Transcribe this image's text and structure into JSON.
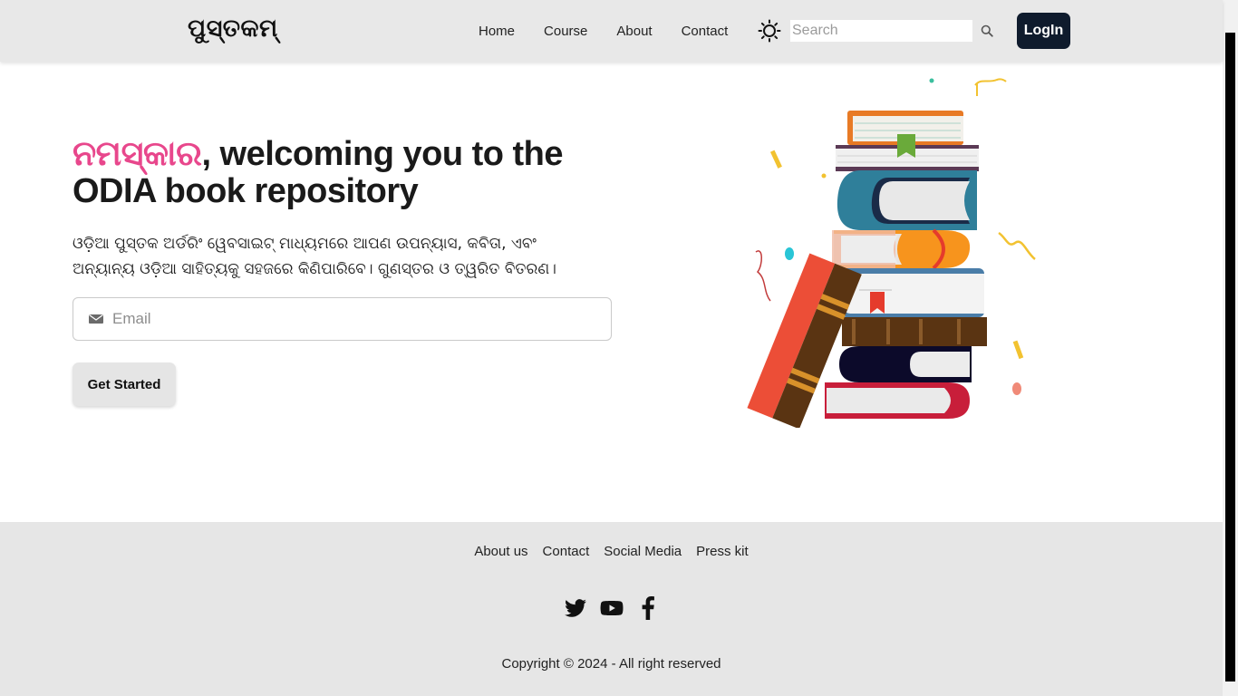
{
  "navbar": {
    "brand": "ପୁସ୍ତକମ୍",
    "links": [
      "Home",
      "Course",
      "About",
      "Contact"
    ],
    "theme_icon": "sun-icon",
    "search_placeholder": "Search",
    "search_icon": "search-icon",
    "login_label": "LogIn"
  },
  "hero": {
    "title_accent": "ନମସ୍କାର",
    "title_rest": ", welcoming you to the ODIA book repository",
    "description": "ଓଡ଼ିଆ ପୁସ୍ତକ ଅର୍ଡରିଂ ୱେବସାଇଟ୍ ମାଧ୍ୟମରେ ଆପଣ ଉପନ୍ୟାସ, କବିତା, ଏବଂ ଅନ୍ୟାନ୍ୟ ଓଡ଼ିଆ ସାହିତ୍ୟକୁ ସହଜରେ କିଣିପାରିବେ। ଗୁଣସ୍ତର ଓ ତ୍ୱରିତ ବିତରଣ।",
    "email_placeholder": "Email",
    "email_icon": "envelope-icon",
    "cta_label": "Get Started",
    "illustration": "stack-of-books-illustration"
  },
  "footer": {
    "links": [
      "About us",
      "Contact",
      "Social Media",
      "Press kit"
    ],
    "social_icons": [
      "twitter-icon",
      "youtube-icon",
      "facebook-icon"
    ],
    "copyright": "Copyright © 2024 - All right reserved"
  },
  "colors": {
    "accent_pink": "#e8478c",
    "login_bg": "#0f1b2d",
    "navbar_bg": "#e8e8e8",
    "footer_bg": "#e6e6e6"
  }
}
